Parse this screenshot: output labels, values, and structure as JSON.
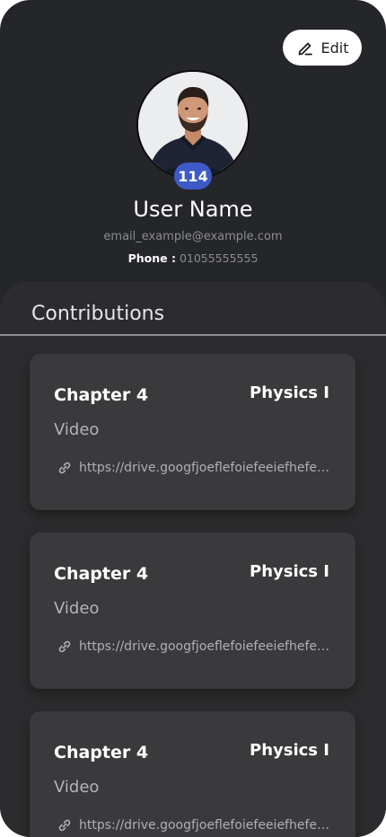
{
  "header": {
    "edit_label": "Edit"
  },
  "profile": {
    "badge_count": "114",
    "name": "User Name",
    "email": "email_example@example.com",
    "phone_label": "Phone :",
    "phone_value": "01055555555"
  },
  "contributions": {
    "title": "Contributions",
    "items": [
      {
        "chapter": "Chapter 4",
        "subject": "Physics I",
        "type": "Video",
        "link": "https://drive.googfjoeflefoiefeeiefhefeoief"
      },
      {
        "chapter": "Chapter 4",
        "subject": "Physics I",
        "type": "Video",
        "link": "https://drive.googfjoeflefoiefeeiefhefeoief"
      },
      {
        "chapter": "Chapter 4",
        "subject": "Physics I",
        "type": "Video",
        "link": "https://drive.googfjoeflefoiefeeiefhefeoief"
      }
    ]
  },
  "colors": {
    "background": "#25262a",
    "panel": "#2c2c2e",
    "card": "#3a3a3c",
    "badge": "#3d5ac6"
  },
  "icons": {
    "edit": "pencil-icon",
    "link": "link-icon"
  }
}
